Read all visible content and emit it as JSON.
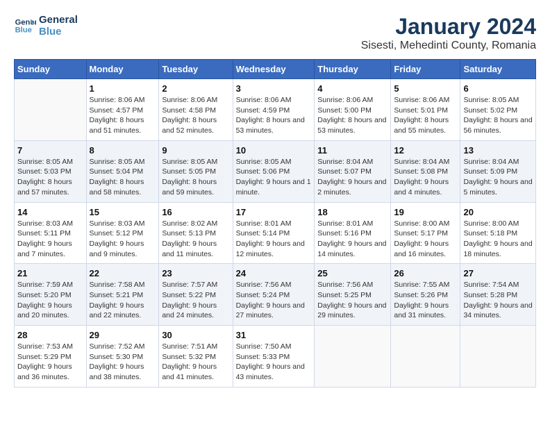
{
  "logo": {
    "line1": "General",
    "line2": "Blue"
  },
  "title": "January 2024",
  "subtitle": "Sisesti, Mehedinti County, Romania",
  "days_header": [
    "Sunday",
    "Monday",
    "Tuesday",
    "Wednesday",
    "Thursday",
    "Friday",
    "Saturday"
  ],
  "weeks": [
    [
      {
        "day": "",
        "sunrise": "",
        "sunset": "",
        "daylight": ""
      },
      {
        "day": "1",
        "sunrise": "Sunrise: 8:06 AM",
        "sunset": "Sunset: 4:57 PM",
        "daylight": "Daylight: 8 hours and 51 minutes."
      },
      {
        "day": "2",
        "sunrise": "Sunrise: 8:06 AM",
        "sunset": "Sunset: 4:58 PM",
        "daylight": "Daylight: 8 hours and 52 minutes."
      },
      {
        "day": "3",
        "sunrise": "Sunrise: 8:06 AM",
        "sunset": "Sunset: 4:59 PM",
        "daylight": "Daylight: 8 hours and 53 minutes."
      },
      {
        "day": "4",
        "sunrise": "Sunrise: 8:06 AM",
        "sunset": "Sunset: 5:00 PM",
        "daylight": "Daylight: 8 hours and 53 minutes."
      },
      {
        "day": "5",
        "sunrise": "Sunrise: 8:06 AM",
        "sunset": "Sunset: 5:01 PM",
        "daylight": "Daylight: 8 hours and 55 minutes."
      },
      {
        "day": "6",
        "sunrise": "Sunrise: 8:05 AM",
        "sunset": "Sunset: 5:02 PM",
        "daylight": "Daylight: 8 hours and 56 minutes."
      }
    ],
    [
      {
        "day": "7",
        "sunrise": "Sunrise: 8:05 AM",
        "sunset": "Sunset: 5:03 PM",
        "daylight": "Daylight: 8 hours and 57 minutes."
      },
      {
        "day": "8",
        "sunrise": "Sunrise: 8:05 AM",
        "sunset": "Sunset: 5:04 PM",
        "daylight": "Daylight: 8 hours and 58 minutes."
      },
      {
        "day": "9",
        "sunrise": "Sunrise: 8:05 AM",
        "sunset": "Sunset: 5:05 PM",
        "daylight": "Daylight: 8 hours and 59 minutes."
      },
      {
        "day": "10",
        "sunrise": "Sunrise: 8:05 AM",
        "sunset": "Sunset: 5:06 PM",
        "daylight": "Daylight: 9 hours and 1 minute."
      },
      {
        "day": "11",
        "sunrise": "Sunrise: 8:04 AM",
        "sunset": "Sunset: 5:07 PM",
        "daylight": "Daylight: 9 hours and 2 minutes."
      },
      {
        "day": "12",
        "sunrise": "Sunrise: 8:04 AM",
        "sunset": "Sunset: 5:08 PM",
        "daylight": "Daylight: 9 hours and 4 minutes."
      },
      {
        "day": "13",
        "sunrise": "Sunrise: 8:04 AM",
        "sunset": "Sunset: 5:09 PM",
        "daylight": "Daylight: 9 hours and 5 minutes."
      }
    ],
    [
      {
        "day": "14",
        "sunrise": "Sunrise: 8:03 AM",
        "sunset": "Sunset: 5:11 PM",
        "daylight": "Daylight: 9 hours and 7 minutes."
      },
      {
        "day": "15",
        "sunrise": "Sunrise: 8:03 AM",
        "sunset": "Sunset: 5:12 PM",
        "daylight": "Daylight: 9 hours and 9 minutes."
      },
      {
        "day": "16",
        "sunrise": "Sunrise: 8:02 AM",
        "sunset": "Sunset: 5:13 PM",
        "daylight": "Daylight: 9 hours and 11 minutes."
      },
      {
        "day": "17",
        "sunrise": "Sunrise: 8:01 AM",
        "sunset": "Sunset: 5:14 PM",
        "daylight": "Daylight: 9 hours and 12 minutes."
      },
      {
        "day": "18",
        "sunrise": "Sunrise: 8:01 AM",
        "sunset": "Sunset: 5:16 PM",
        "daylight": "Daylight: 9 hours and 14 minutes."
      },
      {
        "day": "19",
        "sunrise": "Sunrise: 8:00 AM",
        "sunset": "Sunset: 5:17 PM",
        "daylight": "Daylight: 9 hours and 16 minutes."
      },
      {
        "day": "20",
        "sunrise": "Sunrise: 8:00 AM",
        "sunset": "Sunset: 5:18 PM",
        "daylight": "Daylight: 9 hours and 18 minutes."
      }
    ],
    [
      {
        "day": "21",
        "sunrise": "Sunrise: 7:59 AM",
        "sunset": "Sunset: 5:20 PM",
        "daylight": "Daylight: 9 hours and 20 minutes."
      },
      {
        "day": "22",
        "sunrise": "Sunrise: 7:58 AM",
        "sunset": "Sunset: 5:21 PM",
        "daylight": "Daylight: 9 hours and 22 minutes."
      },
      {
        "day": "23",
        "sunrise": "Sunrise: 7:57 AM",
        "sunset": "Sunset: 5:22 PM",
        "daylight": "Daylight: 9 hours and 24 minutes."
      },
      {
        "day": "24",
        "sunrise": "Sunrise: 7:56 AM",
        "sunset": "Sunset: 5:24 PM",
        "daylight": "Daylight: 9 hours and 27 minutes."
      },
      {
        "day": "25",
        "sunrise": "Sunrise: 7:56 AM",
        "sunset": "Sunset: 5:25 PM",
        "daylight": "Daylight: 9 hours and 29 minutes."
      },
      {
        "day": "26",
        "sunrise": "Sunrise: 7:55 AM",
        "sunset": "Sunset: 5:26 PM",
        "daylight": "Daylight: 9 hours and 31 minutes."
      },
      {
        "day": "27",
        "sunrise": "Sunrise: 7:54 AM",
        "sunset": "Sunset: 5:28 PM",
        "daylight": "Daylight: 9 hours and 34 minutes."
      }
    ],
    [
      {
        "day": "28",
        "sunrise": "Sunrise: 7:53 AM",
        "sunset": "Sunset: 5:29 PM",
        "daylight": "Daylight: 9 hours and 36 minutes."
      },
      {
        "day": "29",
        "sunrise": "Sunrise: 7:52 AM",
        "sunset": "Sunset: 5:30 PM",
        "daylight": "Daylight: 9 hours and 38 minutes."
      },
      {
        "day": "30",
        "sunrise": "Sunrise: 7:51 AM",
        "sunset": "Sunset: 5:32 PM",
        "daylight": "Daylight: 9 hours and 41 minutes."
      },
      {
        "day": "31",
        "sunrise": "Sunrise: 7:50 AM",
        "sunset": "Sunset: 5:33 PM",
        "daylight": "Daylight: 9 hours and 43 minutes."
      },
      {
        "day": "",
        "sunrise": "",
        "sunset": "",
        "daylight": ""
      },
      {
        "day": "",
        "sunrise": "",
        "sunset": "",
        "daylight": ""
      },
      {
        "day": "",
        "sunrise": "",
        "sunset": "",
        "daylight": ""
      }
    ]
  ]
}
